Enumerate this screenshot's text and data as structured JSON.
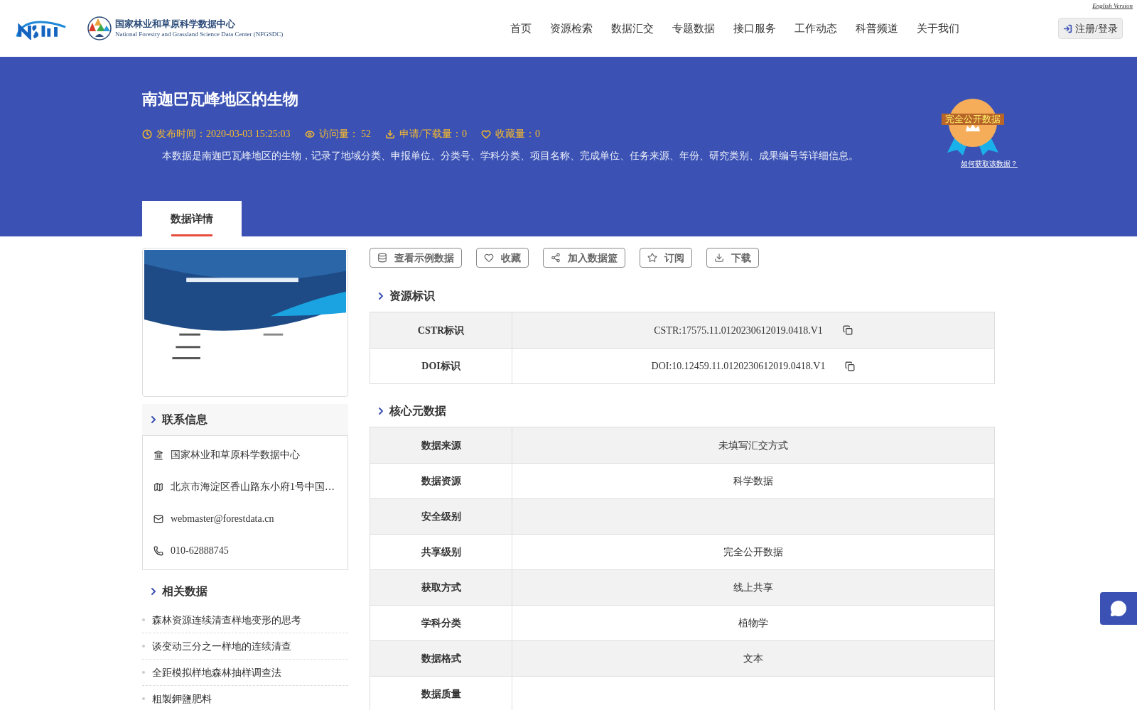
{
  "header": {
    "english_link": "English Version",
    "logo_title": "国家林业和草原科学数据中心",
    "logo_subtitle": "National Forestry and Grassland Science Data Center (NFGSDC)",
    "nav": [
      {
        "label": "首页",
        "selected": false
      },
      {
        "label": "资源检索",
        "selected": false
      },
      {
        "label": "数据汇交",
        "selected": false
      },
      {
        "label": "专题数据",
        "selected": false
      },
      {
        "label": "接口服务",
        "selected": false
      },
      {
        "label": "工作动态",
        "selected": false
      },
      {
        "label": "科普频道",
        "selected": false
      },
      {
        "label": "关于我们",
        "selected": false
      }
    ],
    "login": "注册/登录"
  },
  "banner": {
    "title": "南迦巴瓦峰地区的生物",
    "meta": [
      {
        "kind": "time",
        "text": "发布时间：2020-03-03 15:25:03"
      },
      {
        "kind": "views",
        "text": "访问量： 52"
      },
      {
        "kind": "downloads",
        "text": "申请/下载量：0"
      },
      {
        "kind": "favorites",
        "text": "收藏量：0"
      }
    ],
    "description": "本数据是南迦巴瓦峰地区的生物，记录了地域分类、申报单位、分类号、学科分类、项目名称、完成单位、任务来源、年份、研究类别、成果编号等详细信息。",
    "badge": "完全公开数据",
    "badge_link": "如何获取该数据？"
  },
  "tabs": [
    {
      "label": "数据详情",
      "selected": true
    }
  ],
  "contact": {
    "title": "联系信息",
    "items": [
      {
        "kind": "org",
        "text": "国家林业和草原科学数据中心"
      },
      {
        "kind": "address",
        "text": "北京市海淀区香山路东小府1号中国…"
      },
      {
        "kind": "email",
        "text": "webmaster@forestdata.cn"
      },
      {
        "kind": "phone",
        "text": "010-62888745"
      }
    ]
  },
  "related": {
    "title": "相关数据",
    "items": [
      "森林资源连续清查样地变形的思考",
      "谈变动三分之一样地的连续清查",
      "全距模拟样地森林抽样调查法",
      "粗製鉀鹽肥料"
    ]
  },
  "actions": [
    {
      "kind": "sample",
      "label": "查看示例数据"
    },
    {
      "kind": "favorite",
      "label": "收藏"
    },
    {
      "kind": "basket",
      "label": "加入数据篮"
    },
    {
      "kind": "subscribe",
      "label": "订阅"
    },
    {
      "kind": "download",
      "label": "下载"
    }
  ],
  "identifiers": {
    "title": "资源标识",
    "rows": [
      {
        "label": "CSTR标识",
        "value": "CSTR:17575.11.0120230612019.0418.V1"
      },
      {
        "label": "DOI标识",
        "value": "DOI:10.12459.11.0120230612019.0418.V1"
      }
    ]
  },
  "core_metadata": {
    "title": "核心元数据",
    "rows": [
      {
        "label": "数据来源",
        "value": "未填写汇交方式"
      },
      {
        "label": "数据资源",
        "value": "科学数据"
      },
      {
        "label": "安全级别"
      },
      {
        "label": "共享级别",
        "value": "完全公开数据"
      },
      {
        "label": "获取方式",
        "value": "线上共享"
      },
      {
        "label": "学科分类",
        "value": "植物学"
      },
      {
        "label": "数据格式",
        "value": "文本"
      },
      {
        "label": "数据质量"
      }
    ]
  }
}
